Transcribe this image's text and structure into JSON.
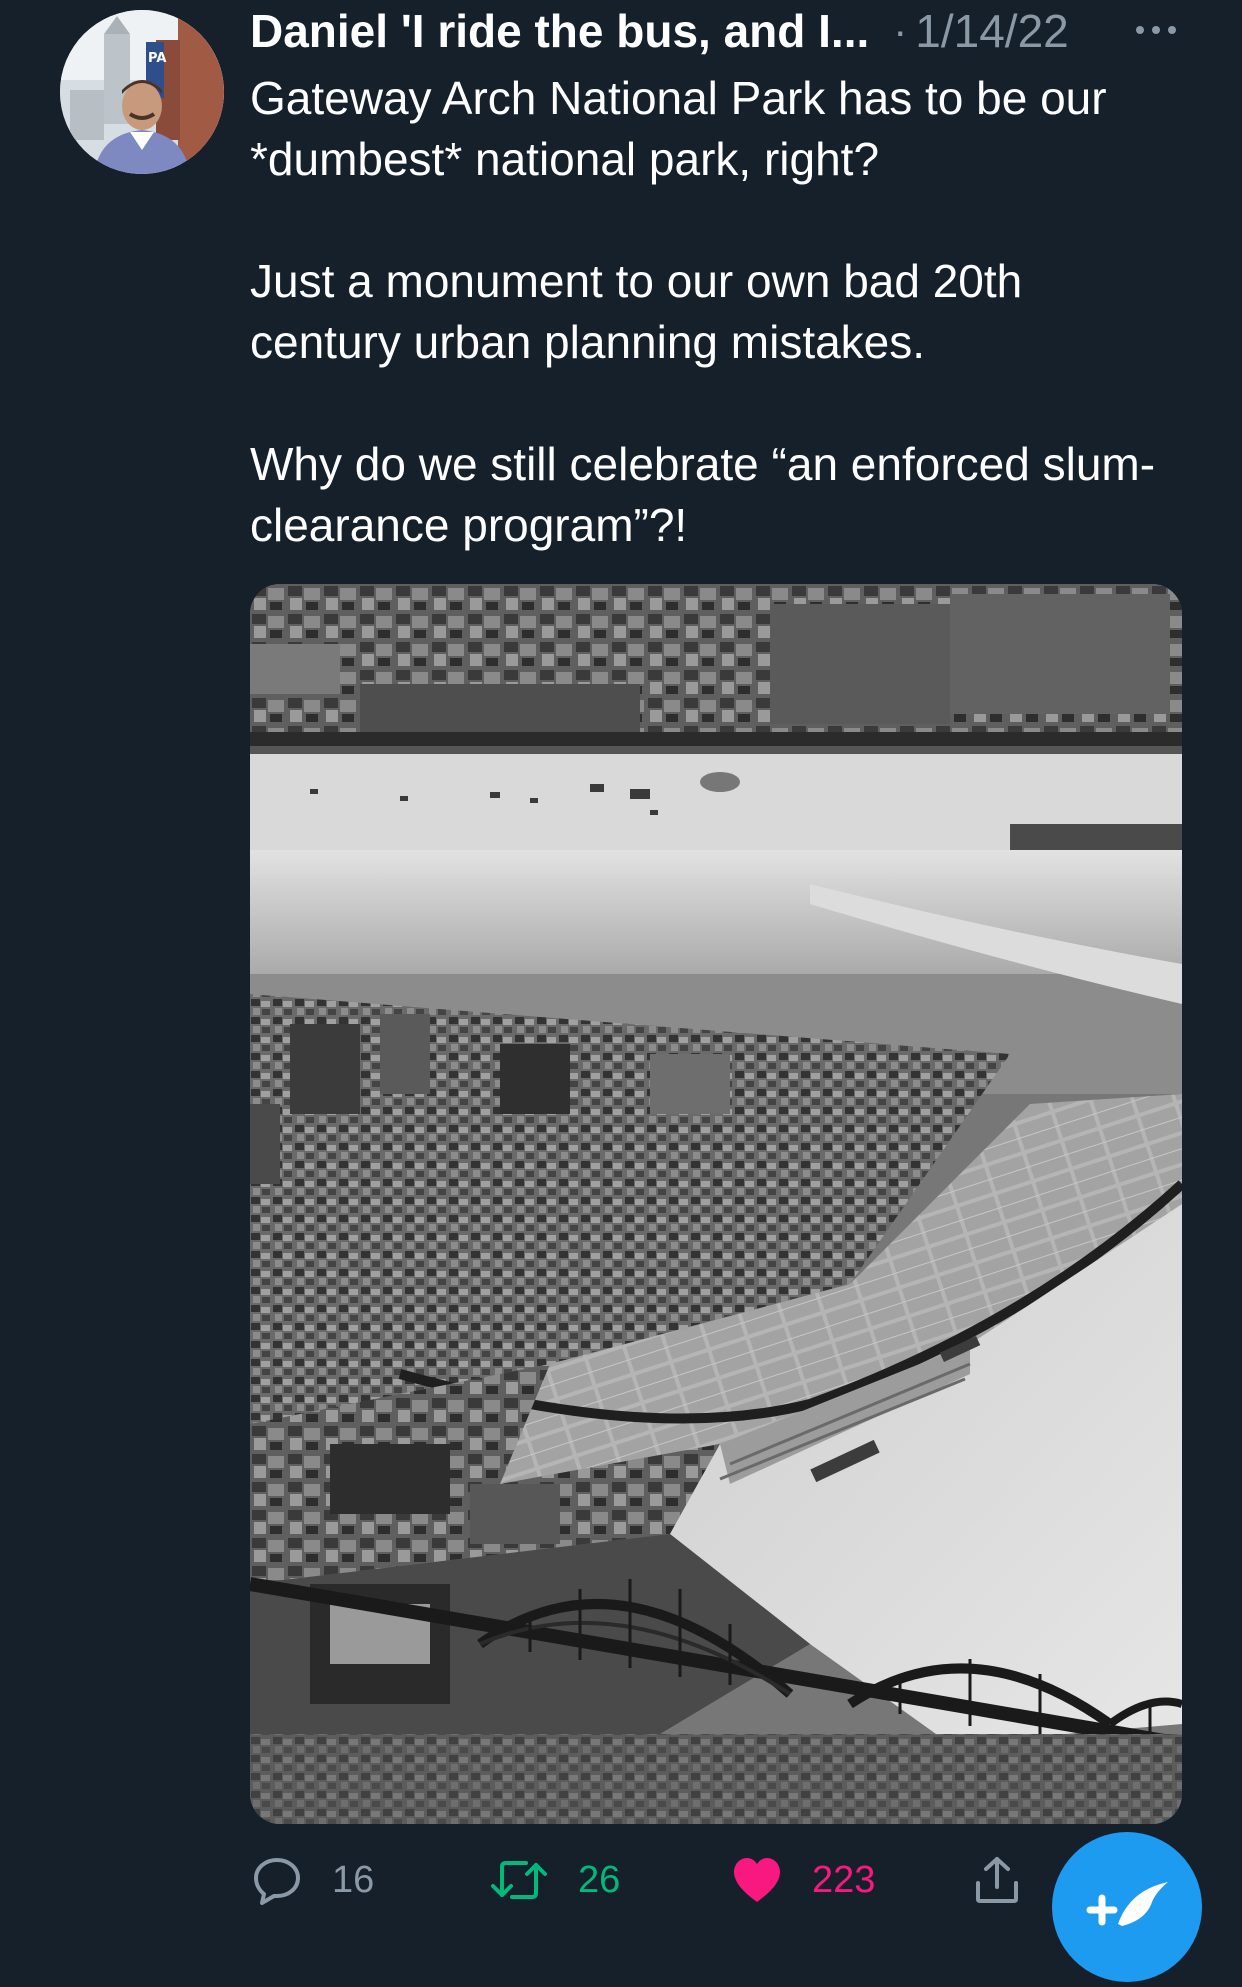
{
  "tweet": {
    "author_name": "Daniel 'I ride the bus, and I...",
    "separator": "·",
    "date": "1/14/22",
    "text": "Gateway Arch National Park has to be our *dumbest* national park, right?\n\nJust a monument to our own bad 20th century urban planning mistakes.\n\nWhy do we still celebrate “an enforced slum-clearance program”?!",
    "avatar_sign_text": "PA"
  },
  "actions": {
    "reply_count": "16",
    "retweet_count": "26",
    "like_count": "223"
  },
  "icons": {
    "more": "more-icon",
    "reply": "reply-icon",
    "retweet": "retweet-icon",
    "like": "heart-icon",
    "share": "share-icon",
    "compose": "compose-icon"
  },
  "colors": {
    "background": "#15202b",
    "secondary_text": "#8b98a5",
    "retweet_green": "#00ba7c",
    "like_pink": "#f91880",
    "compose_blue": "#1d9bf0"
  }
}
